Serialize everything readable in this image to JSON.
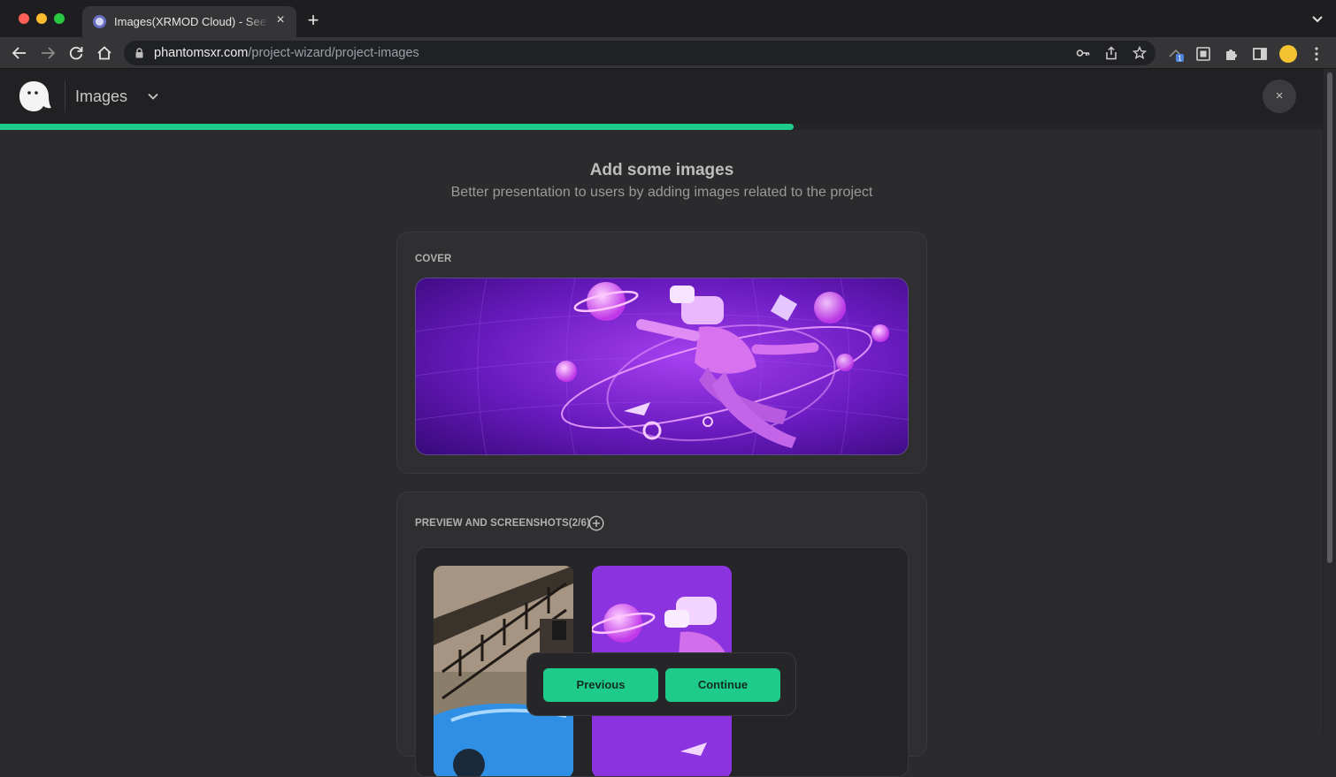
{
  "browser": {
    "tab_title": "Images(XRMOD Cloud) - See the world differently",
    "tab_close": "×",
    "new_tab": "+",
    "url_host": "phantomsxr.com",
    "url_path": "/project-wizard/project-images",
    "extension_badge": "1"
  },
  "header": {
    "section": "Images",
    "close": "×",
    "progress_fraction": 0.6
  },
  "main": {
    "title": "Add some images",
    "subtitle": "Better presentation to users by adding images related to the project",
    "cover_label": "COVER",
    "screenshots_label": "PREVIEW AND SCREENSHOTS(2/6)"
  },
  "actions": {
    "previous": "Previous",
    "continue": "Continue"
  },
  "colors": {
    "accent": "#1fcb8b",
    "background": "#2b2b2d",
    "cover_purple": "#7b1fd0"
  }
}
